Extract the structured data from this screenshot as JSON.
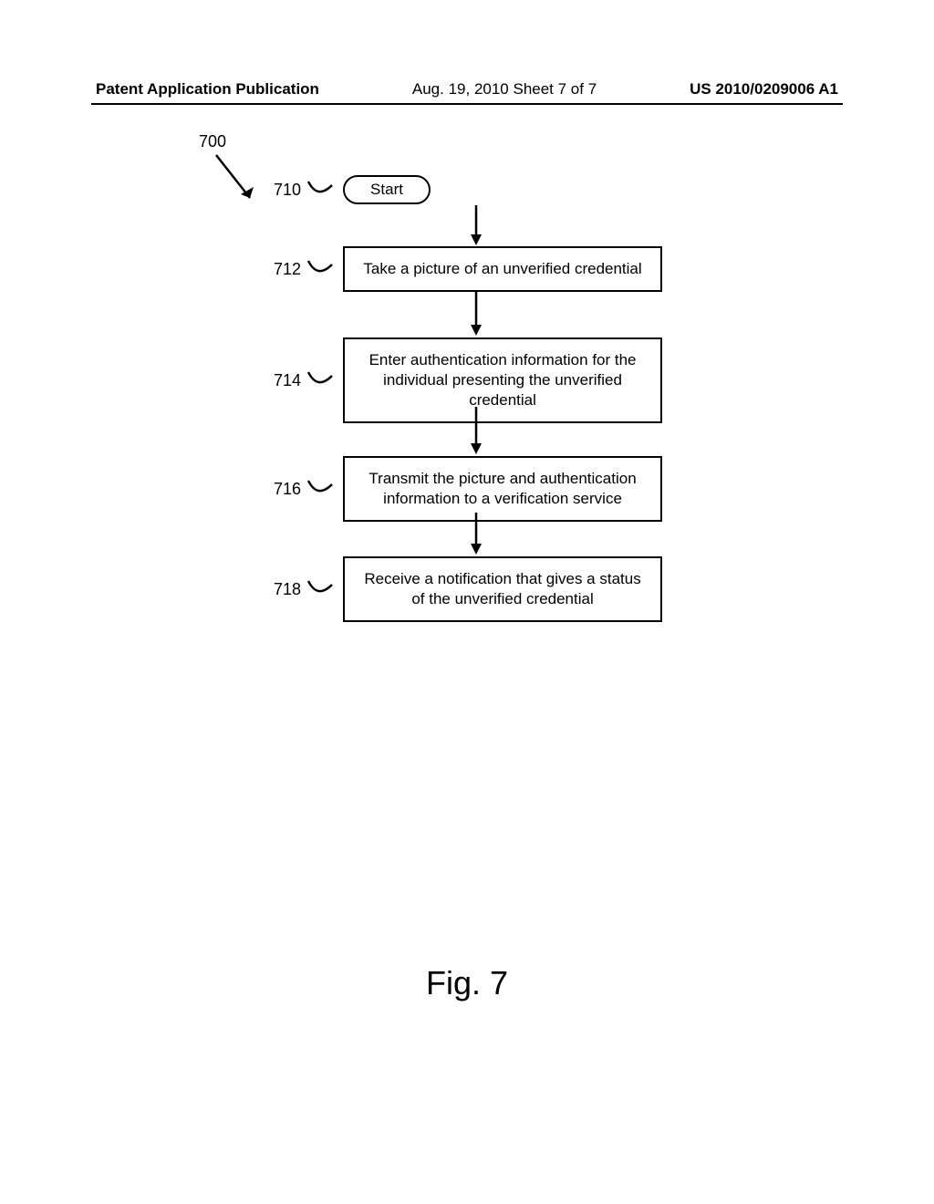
{
  "header": {
    "left": "Patent Application Publication",
    "center": "Aug. 19, 2010  Sheet 7 of 7",
    "right": "US 2010/0209006 A1"
  },
  "diagram": {
    "ref_main": "700",
    "start": {
      "ref": "710",
      "label": "Start"
    },
    "steps": [
      {
        "ref": "712",
        "text": "Take a picture of an unverified credential"
      },
      {
        "ref": "714",
        "text": "Enter authentication information for the individual presenting the unverified credential"
      },
      {
        "ref": "716",
        "text": "Transmit the picture and authentication information to a verification service"
      },
      {
        "ref": "718",
        "text": "Receive a notification that gives a status of the unverified credential"
      }
    ]
  },
  "figure_label": "Fig. 7"
}
